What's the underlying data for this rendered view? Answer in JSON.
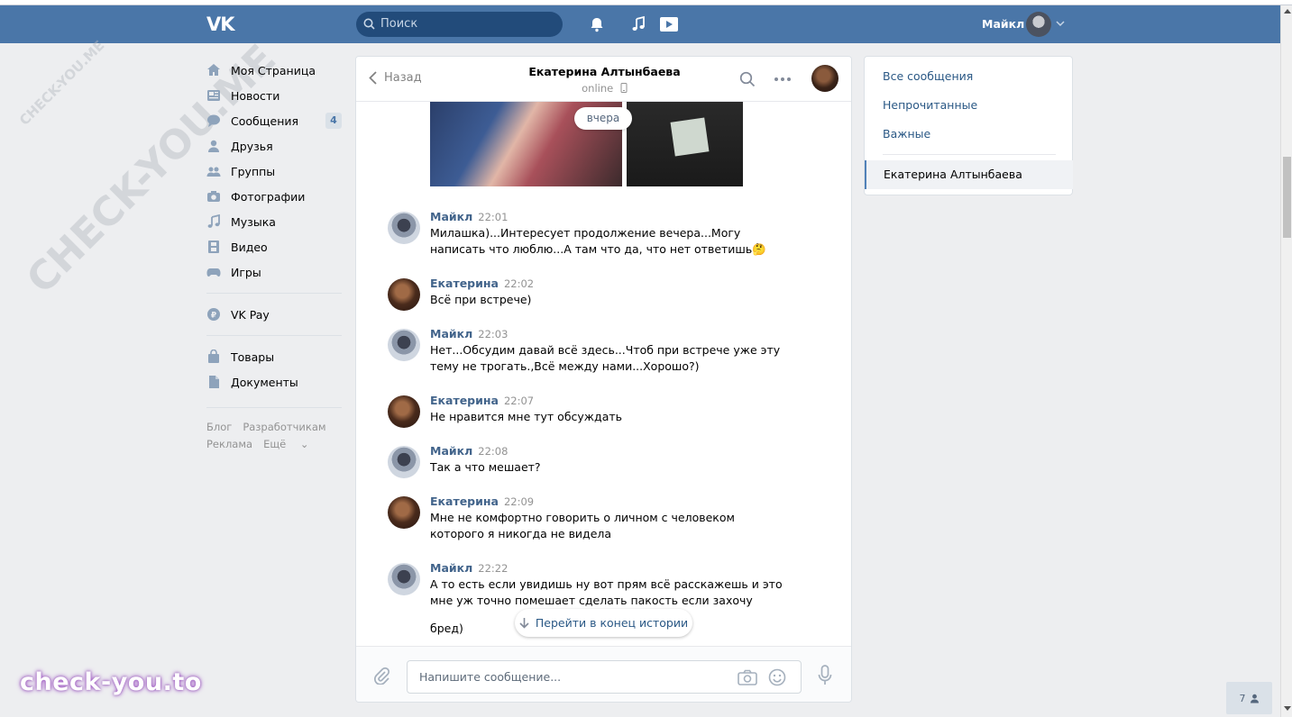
{
  "header": {
    "logo": "VK",
    "search_placeholder": "Поиск",
    "user_name": "Майкл",
    "icons": [
      "bell-icon",
      "music-icon",
      "video-icon"
    ]
  },
  "nav": {
    "items": [
      {
        "label": "Моя Страница",
        "icon": "home-icon"
      },
      {
        "label": "Новости",
        "icon": "news-icon"
      },
      {
        "label": "Сообщения",
        "icon": "messages-icon",
        "badge": "4"
      },
      {
        "label": "Друзья",
        "icon": "friends-icon"
      },
      {
        "label": "Группы",
        "icon": "groups-icon"
      },
      {
        "label": "Фотографии",
        "icon": "camera-icon"
      },
      {
        "label": "Музыка",
        "icon": "music-icon"
      },
      {
        "label": "Видео",
        "icon": "film-icon"
      },
      {
        "label": "Игры",
        "icon": "gamepad-icon"
      }
    ],
    "pay": {
      "label": "VK Pay",
      "icon": "vkpay-icon"
    },
    "extra": [
      {
        "label": "Товары",
        "icon": "bag-icon"
      },
      {
        "label": "Документы",
        "icon": "document-icon"
      }
    ],
    "footer": {
      "blog": "Блог",
      "dev": "Разработчикам",
      "ads": "Реклама",
      "more": "Ещё"
    }
  },
  "chat": {
    "back_label": "Назад",
    "title": "Екатерина Алтынбаева",
    "status": "online",
    "date_pill": "вчера",
    "jump_label": "Перейти в конец истории",
    "input_placeholder": "Напишите сообщение...",
    "messages": [
      {
        "author": "Майкл",
        "time": "22:01",
        "text": "Милашка)...Интересует продолжение вечера...Могу написать что люблю...А там что да, что нет ответишь🤔",
        "from": "m"
      },
      {
        "author": "Екатерина",
        "time": "22:02",
        "text": "Всё при встрече)",
        "from": "e"
      },
      {
        "author": "Майкл",
        "time": "22:03",
        "text": "Нет...Обсудим давай всё здесь...Чтоб при встрече уже эту тему не трогать.,Всё между нами...Хорошо?)",
        "from": "m"
      },
      {
        "author": "Екатерина",
        "time": "22:07",
        "text": "Не нравится мне тут обсуждать",
        "from": "e"
      },
      {
        "author": "Майкл",
        "time": "22:08",
        "text": "Так а что мешает?",
        "from": "m"
      },
      {
        "author": "Екатерина",
        "time": "22:09",
        "text": "Мне не комфортно говорить о личном с человеком которого я никогда не видела",
        "from": "e"
      },
      {
        "author": "Майкл",
        "time": "22:22",
        "text": "А то есть если увидишь ну вот прям всё расскажешь и это мне уж точно помешает сделать пакость если захочу",
        "from": "m"
      }
    ],
    "trailing_text": "бред)"
  },
  "right": {
    "items": [
      "Все сообщения",
      "Непрочитанные",
      "Важные"
    ],
    "active": "Екатерина Алтынбаева"
  },
  "corner_count": "7",
  "watermark": "CHECK-YOU.ME",
  "brand": "check-you.to",
  "colors": {
    "header": "#4a76a8",
    "link": "#2a5885",
    "author": "#42648b",
    "background": "#edeef0"
  }
}
